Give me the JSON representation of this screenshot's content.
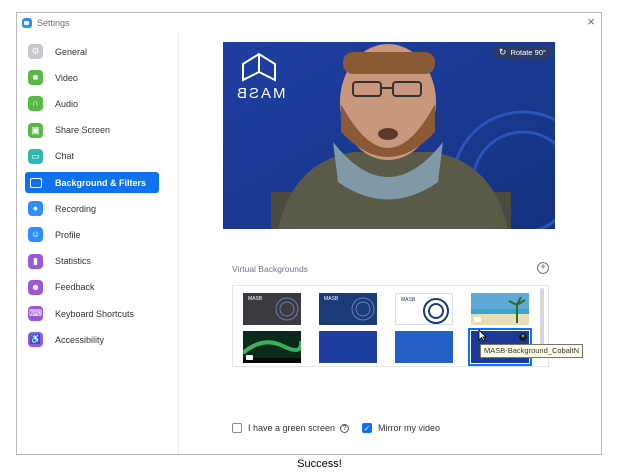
{
  "window": {
    "title": "Settings",
    "close_label": "×"
  },
  "sidebar": {
    "items": [
      {
        "label": "General",
        "icon": "gear-icon",
        "color": "#c8c8cc",
        "glyph": "⚙"
      },
      {
        "label": "Video",
        "icon": "video-camera-icon",
        "color": "#58b947",
        "glyph": "■"
      },
      {
        "label": "Audio",
        "icon": "headphones-icon",
        "color": "#58b947",
        "glyph": "∩"
      },
      {
        "label": "Share Screen",
        "icon": "share-screen-icon",
        "color": "#58b947",
        "glyph": "▣"
      },
      {
        "label": "Chat",
        "icon": "chat-bubble-icon",
        "color": "#2bb9b2",
        "glyph": "▭"
      },
      {
        "label": "Background & Filters",
        "icon": "background-icon",
        "color": "#0e72ed",
        "glyph": "",
        "active": true
      },
      {
        "label": "Recording",
        "icon": "record-icon",
        "color": "#2d8cff",
        "glyph": "●"
      },
      {
        "label": "Profile",
        "icon": "profile-icon",
        "color": "#2d8cff",
        "glyph": "☺"
      },
      {
        "label": "Statistics",
        "icon": "statistics-icon",
        "color": "#9b59d6",
        "glyph": "▮"
      },
      {
        "label": "Feedback",
        "icon": "feedback-icon",
        "color": "#9b59d6",
        "glyph": "☻"
      },
      {
        "label": "Keyboard Shortcuts",
        "icon": "keyboard-icon",
        "color": "#9b59d6",
        "glyph": "⌨"
      },
      {
        "label": "Accessibility",
        "icon": "accessibility-icon",
        "color": "#9b59d6",
        "glyph": "♿"
      }
    ]
  },
  "preview": {
    "rotate_label": "Rotate 90°",
    "logo_text": "MASB"
  },
  "virtual_backgrounds": {
    "label": "Virtual Backgrounds",
    "add_label": "+",
    "thumbnails": [
      {
        "name": "MASB logo dark",
        "text": "MASB",
        "bg": "#3a3a40"
      },
      {
        "name": "MASB logo blue",
        "text": "MASB",
        "bg": "#1b3a7a"
      },
      {
        "name": "MASB logo white",
        "text": "MASB",
        "bg": "#ffffff"
      },
      {
        "name": "beach",
        "text": "",
        "bg": "#5fa8d8"
      },
      {
        "name": "aurora",
        "text": "",
        "bg": "#0c2a1c"
      },
      {
        "name": "MASB blue 1",
        "text": "",
        "bg": "#1e3f9e"
      },
      {
        "name": "MASB blue 2",
        "text": "",
        "bg": "#2360c4"
      },
      {
        "name": "MASB cobalt",
        "text": "",
        "bg": "#1a3c96",
        "selected": true
      }
    ],
    "tooltip": "MASB-Background_CobaltN"
  },
  "options": {
    "green_screen_label": "I have a green screen",
    "green_screen_checked": false,
    "mirror_label": "Mirror my video",
    "mirror_checked": true,
    "help_glyph": "?",
    "check_glyph": "✓"
  },
  "caption": "Success!"
}
